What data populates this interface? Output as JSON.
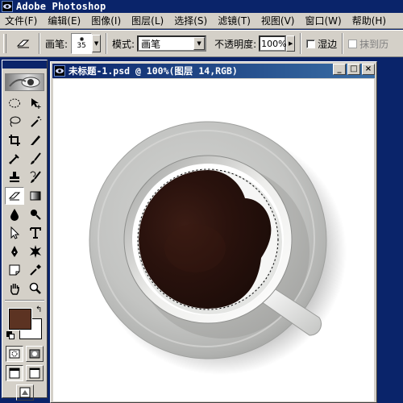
{
  "app": {
    "title": "Adobe Photoshop",
    "icon": "photoshop-eye-icon"
  },
  "menu": {
    "items": [
      "文件(F)",
      "编辑(E)",
      "图像(I)",
      "图层(L)",
      "选择(S)",
      "滤镜(T)",
      "视图(V)",
      "窗口(W)",
      "帮助(H)"
    ]
  },
  "options": {
    "tool_icon": "eraser-icon",
    "brush_label": "画笔:",
    "brush_size": "35",
    "mode_label": "模式:",
    "mode_value": "画笔",
    "opacity_label": "不透明度:",
    "opacity_value": "100%",
    "wet_edges_label": "湿边",
    "erase_to_history_label": "抹到历"
  },
  "toolbox": {
    "tools": [
      "elliptical-marquee-icon",
      "move-icon",
      "lasso-icon",
      "magic-wand-icon",
      "crop-icon",
      "slice-icon",
      "healing-brush-icon",
      "brush-icon",
      "clone-stamp-icon",
      "history-brush-icon",
      "eraser-icon",
      "gradient-icon",
      "blur-icon",
      "burn-icon",
      "path-selection-icon",
      "type-icon",
      "pen-icon",
      "custom-shape-icon",
      "notes-icon",
      "eyedropper-icon",
      "hand-icon",
      "zoom-icon"
    ],
    "active_tool": "eraser-icon",
    "foreground_color": "#5c3322",
    "background_color": "#ffffff"
  },
  "document": {
    "title": "未标题-1.psd @ 100%(图层 14,RGB)",
    "zoom": "100%",
    "layer": "图层 14",
    "color_mode": "RGB"
  },
  "colors": {
    "titlebar": "#0a246a",
    "chrome": "#d4d0c8",
    "coffee": "#2a130e",
    "saucer": "#c8c9c7"
  }
}
